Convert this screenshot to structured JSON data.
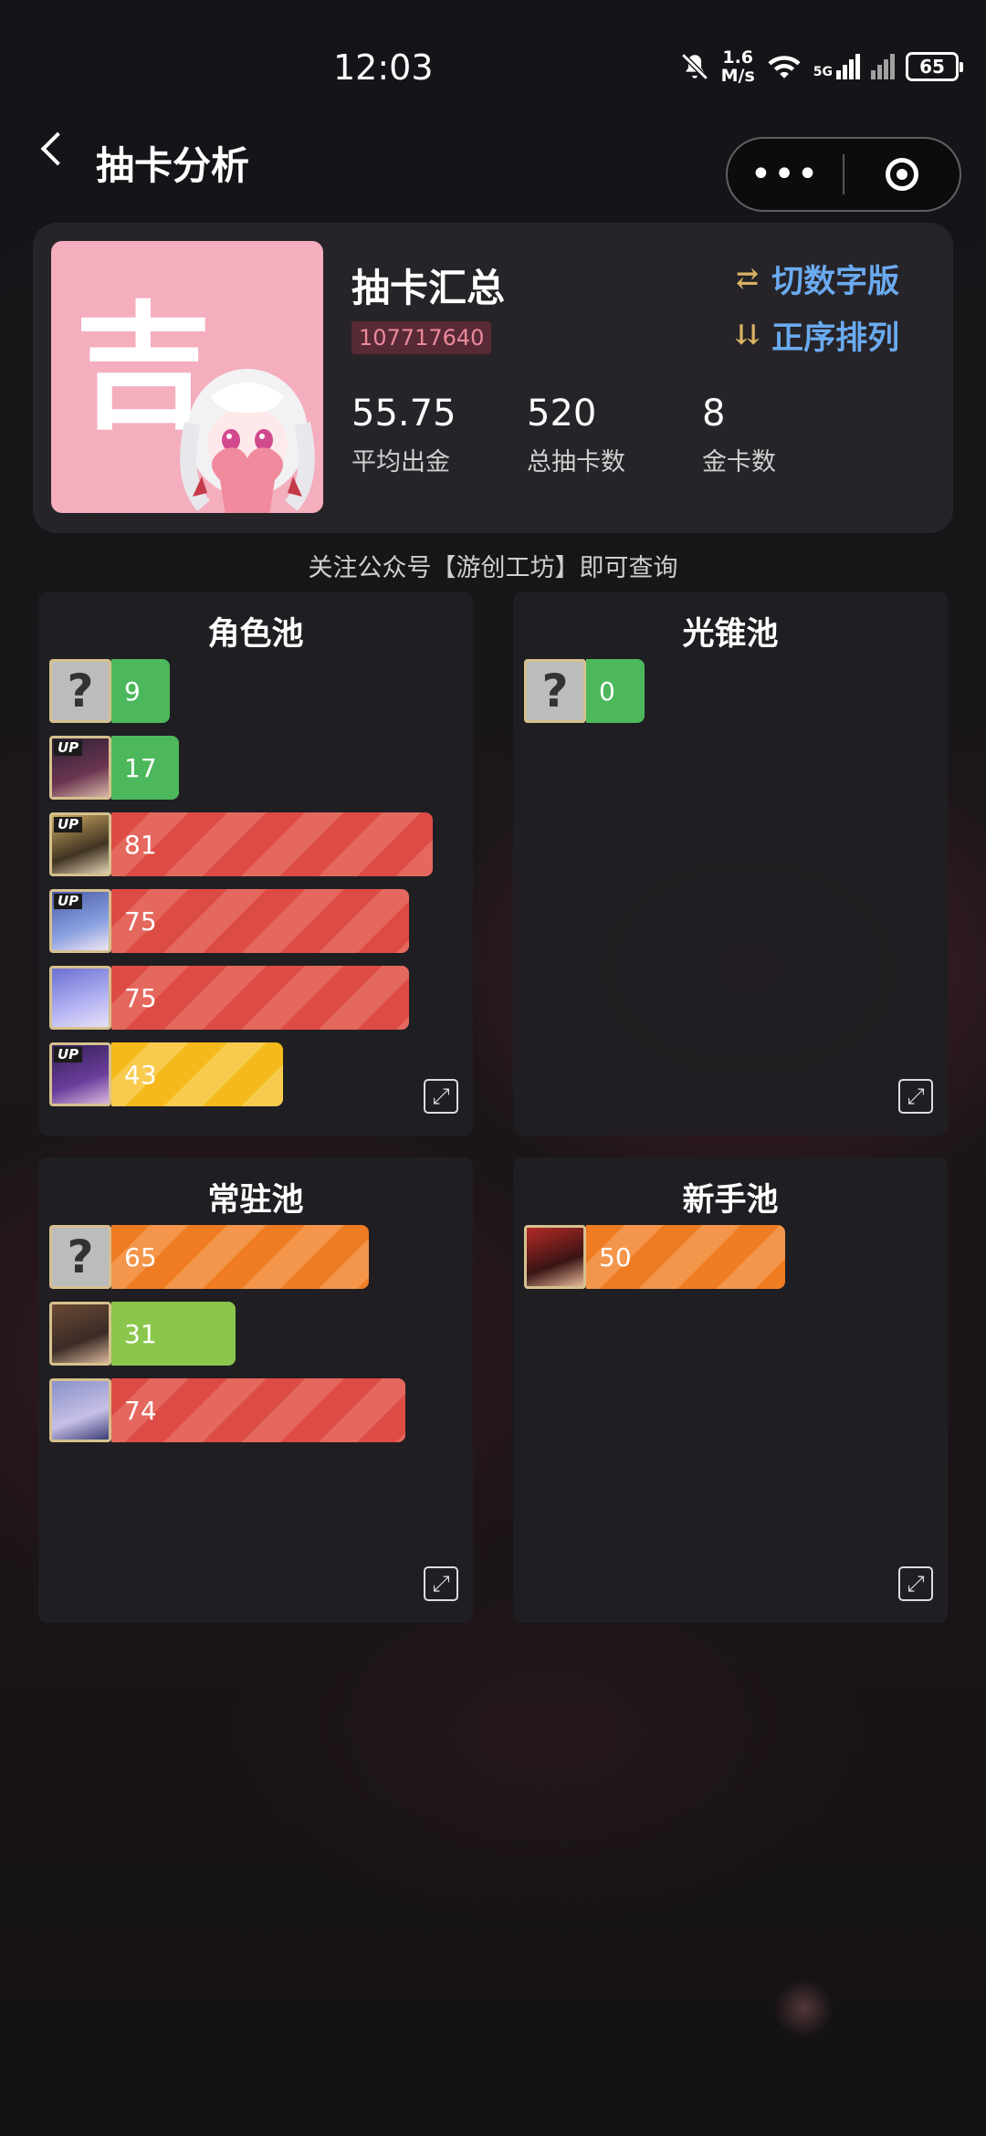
{
  "status_bar": {
    "time": "12:03",
    "speed_top": "1.6",
    "speed_unit": "M/s",
    "network": "5G",
    "battery": "65"
  },
  "header": {
    "title": "抽卡分析"
  },
  "summary": {
    "avatar_char": "吉",
    "title": "抽卡汇总",
    "uid": "107717640",
    "switch_label": "切数字版",
    "sort_label": "正序排列",
    "stats": [
      {
        "value": "55.75",
        "label": "平均出金"
      },
      {
        "value": "520",
        "label": "总抽卡数"
      },
      {
        "value": "8",
        "label": "金卡数"
      }
    ]
  },
  "notice": "关注公众号【游创工坊】即可查询",
  "pools": {
    "character": {
      "title": "角色池",
      "rows": [
        {
          "value": "9",
          "up": ""
        },
        {
          "value": "17",
          "up": "UP"
        },
        {
          "value": "81",
          "up": "UP"
        },
        {
          "value": "75",
          "up": "UP"
        },
        {
          "value": "75",
          "up": ""
        },
        {
          "value": "43",
          "up": "UP"
        }
      ]
    },
    "lightcone": {
      "title": "光锥池",
      "rows": [
        {
          "value": "0",
          "up": ""
        }
      ]
    },
    "standard": {
      "title": "常驻池",
      "rows": [
        {
          "value": "65",
          "up": ""
        },
        {
          "value": "31",
          "up": ""
        },
        {
          "value": "74",
          "up": ""
        }
      ]
    },
    "beginner": {
      "title": "新手池",
      "rows": [
        {
          "value": "50",
          "up": ""
        }
      ]
    }
  },
  "colors": {
    "green": "#4cb85b",
    "red": "#dd4b45",
    "orange": "#ef7b22",
    "yellow": "#f5b91c",
    "link_blue": "#6aaaf0"
  }
}
